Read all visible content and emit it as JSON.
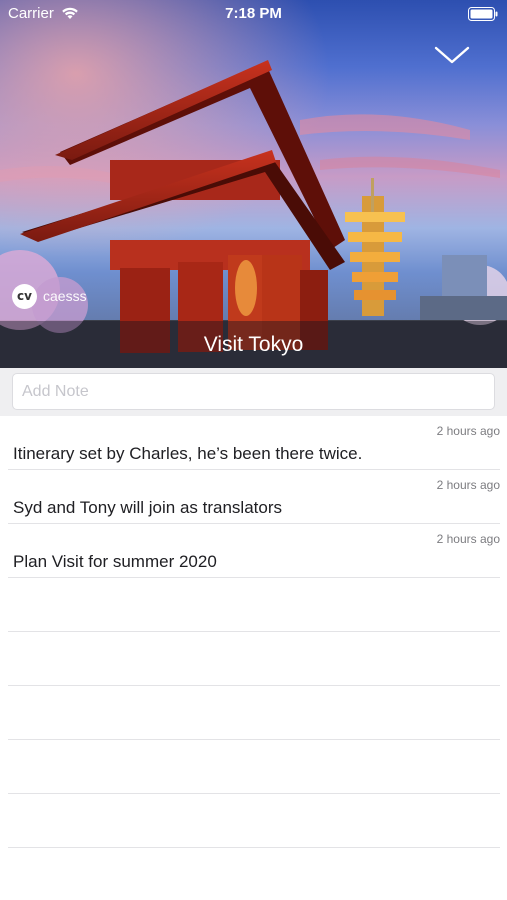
{
  "status_bar": {
    "carrier": "Carrier",
    "time": "7:18 PM"
  },
  "hero": {
    "title": "Visit Tokyo",
    "owner_name": "caesss",
    "owner_avatar_text": "cv"
  },
  "note_input": {
    "placeholder": "Add Note",
    "value": ""
  },
  "notes": [
    {
      "time": "2 hours ago",
      "text": "Itinerary set by Charles, he’s been there twice."
    },
    {
      "time": "2 hours ago",
      "text": "Syd and Tony will join as translators"
    },
    {
      "time": "2 hours ago",
      "text": "Plan Visit for summer 2020"
    }
  ],
  "icons": {
    "wifi": "wifi-icon",
    "battery": "battery-icon",
    "dismiss": "chevron-down-icon"
  }
}
